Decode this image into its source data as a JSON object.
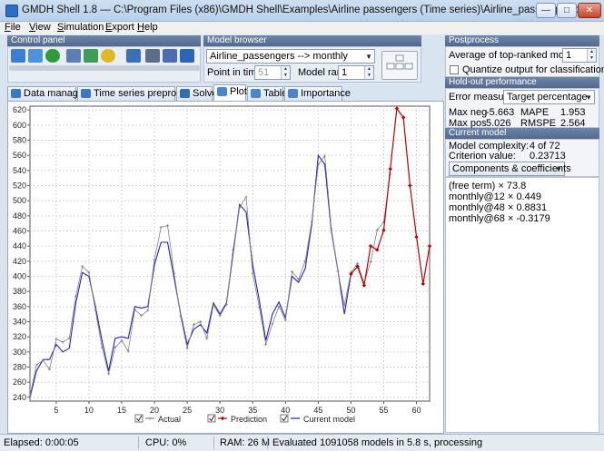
{
  "window": {
    "title": "GMDH Shell 1.8 — C:\\Program Files (x86)\\GMDH Shell\\Examples\\Airline passengers (Time series)\\Airline_passengers.csv"
  },
  "menu": [
    {
      "label": "File",
      "u": "F",
      "rest": "ile"
    },
    {
      "label": "View",
      "u": "V",
      "rest": "iew"
    },
    {
      "label": "Simulation",
      "u": "S",
      "rest": "imulation"
    },
    {
      "label": "Export",
      "u": "E",
      "rest": "xport"
    },
    {
      "label": "Help",
      "u": "H",
      "rest": "elp"
    }
  ],
  "control_panel": {
    "title": "Control panel"
  },
  "model_browser": {
    "title": "Model browser",
    "model_select": "Airline_passengers --> monthly",
    "point_in_time_label": "Point in time",
    "point_in_time_value": "51",
    "model_rank_label": "Model rank",
    "model_rank_value": "1"
  },
  "tabs": [
    "Data manager",
    "Time series preprocess",
    "Solver",
    "Plot",
    "Table",
    "Importance"
  ],
  "active_tab": "Plot",
  "postprocess": {
    "title": "Postprocess",
    "avg_label": "Average of top-ranked models",
    "avg_value": "1",
    "quantize_label": "Quantize output for classification"
  },
  "holdout": {
    "title": "Hold-out performance",
    "error_measure_label": "Error measure",
    "error_measure_value": "Target percentage",
    "max_neg_label": "Max neg",
    "max_neg_value": "-5.663",
    "mape_label": "MAPE",
    "mape_value": "1.953",
    "max_pos_label": "Max pos",
    "max_pos_value": "5.026",
    "rmspe_label": "RMSPE",
    "rmspe_value": "2.564"
  },
  "current_model": {
    "title": "Current model",
    "complexity_label": "Model complexity:",
    "complexity_value": "4 of 72",
    "criterion_label": "Criterion value:",
    "criterion_value": "0.23713",
    "components_button": "Components & coefficients",
    "coefficients": [
      "(free term) × 73.8",
      "monthly@12 × 0.449",
      "monthly@48 × 0.8831",
      "monthly@68 × -0.3179"
    ]
  },
  "status": {
    "elapsed": "Elapsed: 0:00:05",
    "cpu": "CPU: 0%",
    "ram": "RAM: 26 M",
    "message": "Evaluated 1091058 models in 5.8 s, processing"
  },
  "colors": {
    "actual": "#808080",
    "prediction": "#c00000",
    "current_model": "#2020c0",
    "accent": "#53698d"
  },
  "chart_data": {
    "type": "line",
    "xlim": [
      1,
      62
    ],
    "ylim": [
      235,
      625
    ],
    "yticks": [
      240,
      260,
      280,
      300,
      320,
      340,
      360,
      380,
      400,
      420,
      440,
      460,
      480,
      500,
      520,
      540,
      560,
      580,
      600,
      620
    ],
    "xticks": [
      5,
      10,
      15,
      20,
      25,
      30,
      35,
      40,
      45,
      50,
      55,
      60
    ],
    "grid": true,
    "legend": "bottom",
    "series": [
      {
        "name": "Actual",
        "x": [
          1,
          2,
          3,
          4,
          5,
          6,
          7,
          8,
          9,
          10,
          11,
          12,
          13,
          14,
          15,
          16,
          17,
          18,
          19,
          20,
          21,
          22,
          23,
          24,
          25,
          26,
          27,
          28,
          29,
          30,
          31,
          32,
          33,
          34,
          35,
          36,
          37,
          38,
          39,
          40,
          41,
          42,
          43,
          44,
          45,
          46,
          47,
          48,
          49,
          50,
          51,
          52,
          53,
          54,
          55,
          56
        ],
        "values": [
          242,
          283,
          289,
          277,
          317,
          313,
          318,
          374,
          413,
          405,
          355,
          306,
          271,
          306,
          315,
          301,
          356,
          348,
          355,
          422,
          465,
          467,
          404,
          347,
          305,
          336,
          340,
          318,
          362,
          348,
          363,
          435,
          491,
          505,
          404,
          359,
          310,
          337,
          360,
          342,
          406,
          396,
          420,
          472,
          548,
          559,
          463,
          407,
          362,
          405,
          417,
          391,
          419,
          461,
          472,
          535
        ]
      },
      {
        "name": "Prediction",
        "x": [
          50,
          51,
          52,
          53,
          54,
          55,
          56,
          57,
          58,
          59,
          60,
          61,
          62
        ],
        "values": [
          403,
          413,
          388,
          440,
          435,
          461,
          542,
          622,
          610,
          520,
          452,
          390,
          440
        ]
      },
      {
        "name": "Current model",
        "x": [
          1,
          2,
          3,
          4,
          5,
          6,
          7,
          8,
          9,
          10,
          11,
          12,
          13,
          14,
          15,
          16,
          17,
          18,
          19,
          20,
          21,
          22,
          23,
          24,
          25,
          26,
          27,
          28,
          29,
          30,
          31,
          32,
          33,
          34,
          35,
          36,
          37,
          38,
          39,
          40,
          41,
          42,
          43,
          44,
          45,
          46,
          47,
          48,
          49,
          50
        ],
        "values": [
          240,
          275,
          290,
          290,
          310,
          300,
          305,
          365,
          405,
          400,
          360,
          315,
          275,
          318,
          320,
          318,
          360,
          358,
          360,
          415,
          445,
          445,
          398,
          350,
          310,
          330,
          336,
          325,
          365,
          350,
          365,
          430,
          495,
          485,
          415,
          368,
          315,
          350,
          366,
          345,
          400,
          392,
          410,
          468,
          560,
          548,
          460,
          408,
          350,
          403
        ]
      }
    ]
  }
}
